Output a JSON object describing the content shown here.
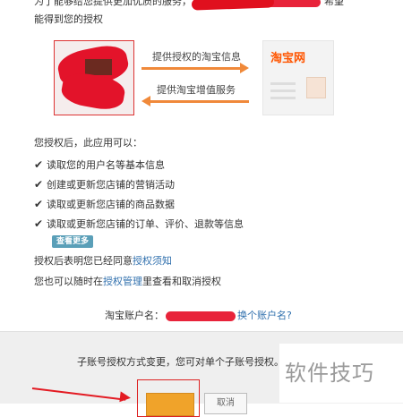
{
  "header": {
    "line1": "为了能够给您提供更加优质的服务，",
    "line1_suffix": "希望",
    "line2": "能得到您的授权"
  },
  "diagram": {
    "arrow_right_label": "提供授权的淘宝信息",
    "arrow_left_label": "提供淘宝增值服务",
    "taobao_logo": "淘宝网"
  },
  "permissions": {
    "intro": "您授权后，此应用可以：",
    "items": [
      "读取您的用户名等基本信息",
      "创建或更新您店铺的营销活动",
      "读取或更新您店铺的商品数据",
      "读取或更新您店铺的订单、评价、退款等信息"
    ],
    "more_button": "查看更多"
  },
  "notes": {
    "agree_prefix": "授权后表明您已经同意",
    "agree_link": "授权须知",
    "revoke_prefix": "您也可以随时在",
    "revoke_link": "授权管理",
    "revoke_suffix": "里查看和取消授权"
  },
  "account": {
    "label": "淘宝账户名：",
    "switch_link": "换个账户名?"
  },
  "footer": {
    "text": "子账号授权方式变更，您可对单个子账号授权。",
    "cancel_label": "取消"
  },
  "watermark": "软件技巧",
  "colors": {
    "accent_orange": "#f0893a",
    "button_orange": "#f0a32a",
    "link_blue": "#2f6fad",
    "redaction_red": "#e8233a"
  }
}
